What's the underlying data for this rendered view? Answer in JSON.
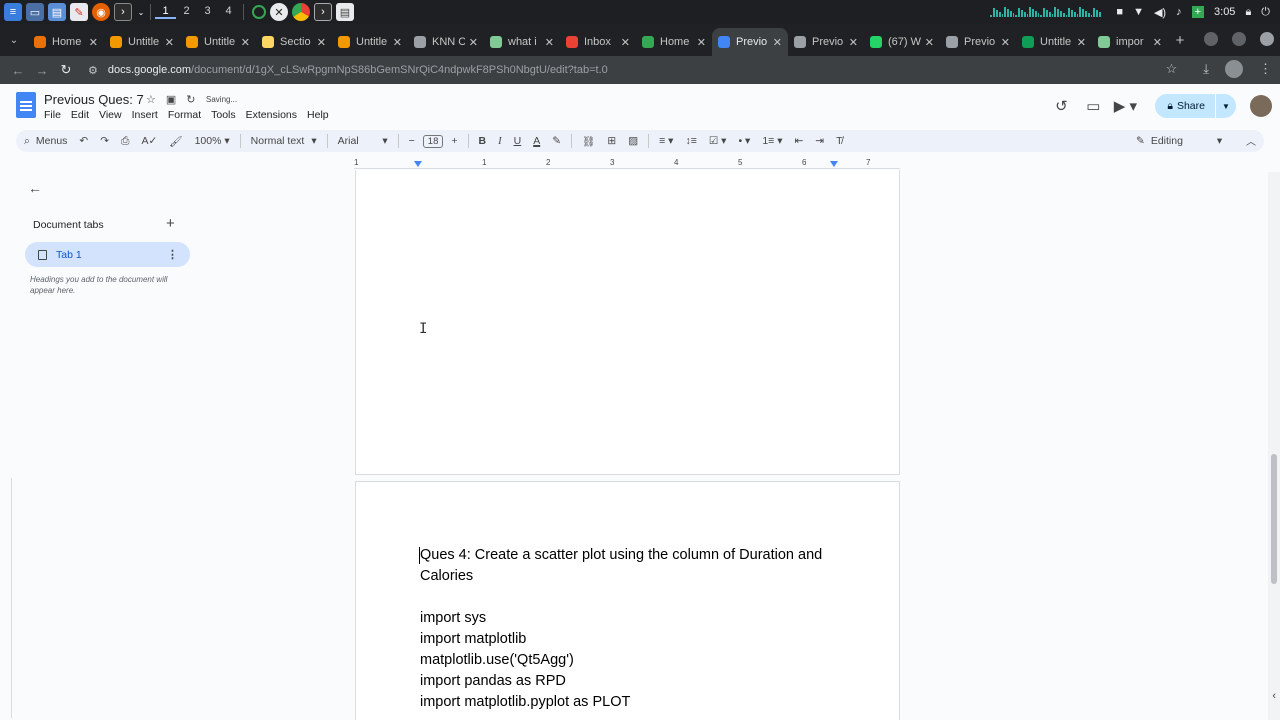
{
  "os": {
    "workspaces": [
      "1",
      "2",
      "3",
      "4"
    ],
    "active_workspace": "1",
    "clock": "3:05"
  },
  "browser": {
    "tabs": [
      {
        "label": "Home",
        "color": "#e8710a"
      },
      {
        "label": "Untitle",
        "color": "#f29900"
      },
      {
        "label": "Untitle",
        "color": "#f29900"
      },
      {
        "label": "Sectio",
        "color": "#fdd663"
      },
      {
        "label": "Untitle",
        "color": "#f29900"
      },
      {
        "label": "KNN C",
        "color": "#9aa0a6"
      },
      {
        "label": "what i",
        "color": "#81c995"
      },
      {
        "label": "Inbox",
        "color": "#ea4335"
      },
      {
        "label": "Home",
        "color": "#34a853"
      },
      {
        "label": "Previo",
        "color": "#4285f4"
      },
      {
        "label": "Previo",
        "color": "#9aa0a6"
      },
      {
        "label": "(67) W",
        "color": "#25d366"
      },
      {
        "label": "Previo",
        "color": "#9aa0a6"
      },
      {
        "label": "Untitle",
        "color": "#0f9d58"
      },
      {
        "label": "impor",
        "color": "#81c995"
      }
    ],
    "active_tab_index": 9,
    "new_tab": "+",
    "url_host": "docs.google.com",
    "url_path": "/document/d/1gX_cLSwRpgmNpS86bGemSNrQiC4ndpwkF8PSh0NbgtU/edit?tab=t.0"
  },
  "docs": {
    "title": "Previous Ques: 7",
    "status": "Saving...",
    "menu": [
      "File",
      "Edit",
      "View",
      "Insert",
      "Format",
      "Tools",
      "Extensions",
      "Help"
    ],
    "share_label": "Share",
    "toolbar": {
      "menus_label": "Menus",
      "zoom": "100%",
      "style": "Normal text",
      "font": "Arial",
      "font_size": "18",
      "minus": "−",
      "plus": "+",
      "editing_label": "Editing"
    },
    "ruler_numbers": [
      "1",
      "1",
      "2",
      "3",
      "4",
      "5",
      "6",
      "7"
    ]
  },
  "sidebar": {
    "title": "Document tabs",
    "add": "+",
    "tab_name": "Tab 1",
    "hint": "Headings you add to the document will appear here."
  },
  "document": {
    "lines": [
      "Ques 4: Create a scatter plot using the column of Duration and Calories",
      "",
      "import sys",
      "import matplotlib",
      "matplotlib.use('Qt5Agg')",
      "import pandas as RPD",
      "import matplotlib.pyplot as PLOT"
    ]
  }
}
